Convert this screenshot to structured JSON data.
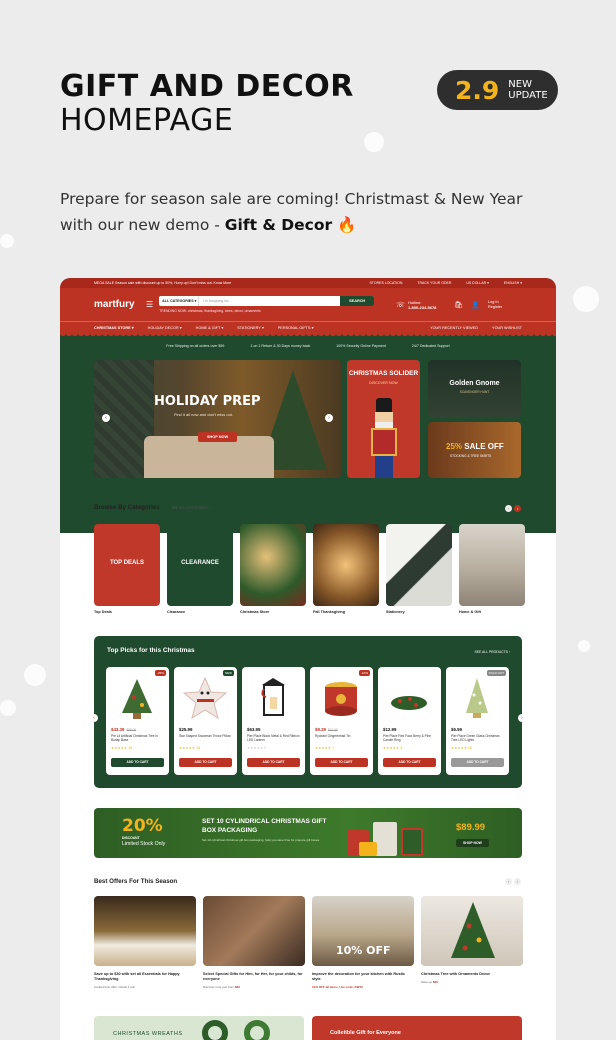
{
  "hero": {
    "title_line1": "GIFT AND DECOR",
    "title_line2": "HOMEPAGE",
    "version": "2.9",
    "new_label": "NEW",
    "update_label": "UPDATE",
    "intro_text": "Prepare for season sale are coming! Christmast & New Year with our new demo - ",
    "intro_bold": "Gift & Decor",
    "intro_emoji": "🔥"
  },
  "site": {
    "topstrip": {
      "announcement": "MEGA SALE Season sale with discount up to 50%, Hurry up! Don't miss out. Know More",
      "links": [
        "STORES LOCATION",
        "TRACK YOUR ODER",
        "US DOLLAR ▾",
        "ENGLISH ▾"
      ]
    },
    "header": {
      "logo": "martfury",
      "search_category": "ALL CATEGORIES ▾",
      "search_placeholder": "I'm shopping for...",
      "search_button": "SEARCH",
      "trending": "TRENDING NOW: christmas, thanksgiving, trees, decor, ornaments",
      "hotline_label": "Hotline:",
      "hotline_number": "1-800-234-5678",
      "login": "Log In",
      "register": "Register"
    },
    "nav": {
      "items": [
        "CHRISTMAS STORE ▾",
        "HOLIDAY DECOR ▾",
        "HOME & GIFT ▾",
        "STATIONERY ▾",
        "PERSONAL GIFTS ▾"
      ],
      "right": [
        "YOUR RECENTLY VIEWED",
        "YOUR WISHLIST"
      ]
    },
    "features": [
      "Free Shipping on all orders over $99",
      "1 on 1 Return & 30 Days money back",
      "100% Security Online Payment",
      "24/7 Dedicated Support"
    ],
    "banners": {
      "main_title": "HOLIDAY PREP",
      "main_sub": "Find it all now and don't miss out.",
      "main_button": "SHOP NOW",
      "mid_title": "CHRISTMAS SOLIDER",
      "mid_link": "DISCOVER NOW",
      "r1_title": "Golden Gnome",
      "r1_sub": "SCAVENGER HUNT",
      "r2_pct": "25%",
      "r2_title": " SALE OFF",
      "r2_sub": "STOCKING & TREE SKIRTS"
    },
    "categories": {
      "heading": "Browse By Categories",
      "see_all": "SEE ALL CATEGORIES ›",
      "items": [
        {
          "name": "Top Deals",
          "overlay": "TOP DEALS"
        },
        {
          "name": "Clearance",
          "overlay": "CLEARANCE"
        },
        {
          "name": "Christmas Store",
          "overlay": ""
        },
        {
          "name": "Fall Thanksgiving",
          "overlay": ""
        },
        {
          "name": "Stationery",
          "overlay": ""
        },
        {
          "name": "Home & Gift",
          "overlay": ""
        }
      ]
    },
    "picks": {
      "heading": "Top Picks for this Christmas",
      "see_all": "SEE ALL PRODUCTS ›",
      "products": [
        {
          "price": "$43.39",
          "old": "$55.00",
          "name": "Pre Lit Artificial Christmas Tree in Burlap Base",
          "tag": "-25%",
          "reviews": "★★★★★ 15",
          "button": "ADD TO CART"
        },
        {
          "price": "$25.99",
          "old": "",
          "name": "Star Shaped Snowman Throw Pillow",
          "tag": "NEW",
          "reviews": "★★★★★ 18",
          "button": "ADD TO CART"
        },
        {
          "price": "$63.95",
          "old": "",
          "name": "Pier Place Black Metal & Red Ribbon LED Lantern",
          "tag": "",
          "reviews": "★★★★★ 0",
          "button": "ADD TO CART"
        },
        {
          "price": "$9.29",
          "old": "$10.00",
          "name": "Ryobani Gingerbread Tin",
          "tag": "-10%",
          "reviews": "★★★★★ 7",
          "button": "ADD TO CART"
        },
        {
          "price": "$12.99",
          "old": "",
          "name": "Pier Place Red Faux Berry & Pine Candle Ring",
          "tag": "",
          "reviews": "★★★★★ 3",
          "button": "ADD TO CART"
        },
        {
          "price": "$6.59",
          "old": "",
          "name": "Pier Place Green Glass Christmas Tree LED Lights",
          "tag": "SOLD OUT",
          "reviews": "★★★★★ 26",
          "button": "ADD TO CART"
        }
      ]
    },
    "promo": {
      "pct": "20%",
      "discount": "DISCOUNT",
      "limited": "Limited Stock Only",
      "title": "SET 10 CYLINDRICAL CHRISTMAS GIFT BOX PACKAGING",
      "sub": "Set 10 cylindrical christmas gift box packaging, help you save time for prepare gift boxes",
      "price": "$89.99",
      "button": "SHOP NOW"
    },
    "offers": {
      "heading": "Best Offers For This Season",
      "items": [
        {
          "title": "Save up to $30 with set all Essentials for Happy Thanksgiving",
          "sub_pre": "Limited time offer. Check it out!",
          "sub_hl": ""
        },
        {
          "title": "Select Special Gifts for Him, for Her, for your childs, for everyone",
          "sub_pre": "Discover now, just from ",
          "sub_hl": "$39"
        },
        {
          "title": "Improve the decoration for your kitchen with Rustic style",
          "sub_pre": "",
          "sub_hl": "10% OFF all items, Use code: KW10"
        },
        {
          "title": "Christmas Tree with Ornaments Decor",
          "sub_pre": "Save up ",
          "sub_hl": "$30"
        }
      ],
      "overlay_10off": "10% OFF"
    },
    "bottom": {
      "left": "CHRISTMAS WREATHS",
      "right": "Colletible Gift for Everyone"
    }
  },
  "colors": {
    "brand_red": "#bd3323",
    "brand_green": "#1f4a2d",
    "accent_yellow": "#f4b31a"
  }
}
